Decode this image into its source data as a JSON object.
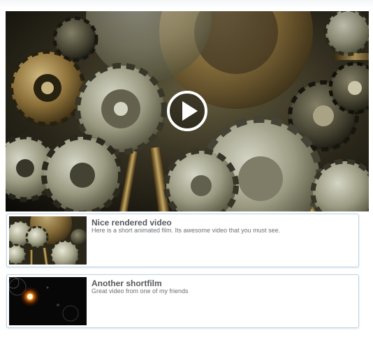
{
  "player": {
    "play_icon": "play-icon",
    "background": "#1a1712"
  },
  "playlist": {
    "items": [
      {
        "title": "Nice rendered video",
        "description": "Here is a short animated film. Its awesome video that you must see.",
        "thumbnail": "gears-thumbnail"
      },
      {
        "title": "Another shortfilm",
        "description": "Great video from one of my friends",
        "thumbnail": "light-flare-thumbnail"
      }
    ]
  },
  "colors": {
    "border": "#bcd3e4",
    "title_text": "#55595d",
    "desc_text": "#6b6f73"
  }
}
